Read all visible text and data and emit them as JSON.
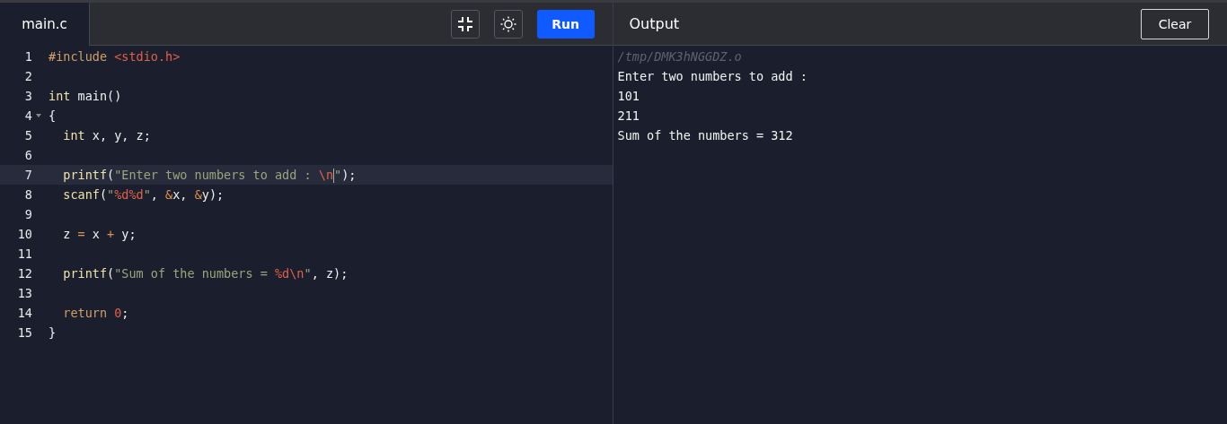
{
  "editor": {
    "tab": {
      "label": "main.c",
      "selected": true
    },
    "buttons": [
      {
        "kind": "collapse"
      },
      {
        "kind": "theme"
      },
      {
        "kind": "run",
        "label": "Run"
      }
    ],
    "lines": [
      {
        "number": "1",
        "active": false,
        "foldable": false,
        "indented": false,
        "tokens": [
          {
            "kind": "directive",
            "text": "#include "
          },
          {
            "kind": "header",
            "text": "<stdio.h>"
          }
        ]
      },
      {
        "number": "2",
        "active": false,
        "foldable": false
      },
      {
        "number": "3",
        "active": false,
        "foldable": false,
        "indented": false,
        "tokens": [
          {
            "kind": "type",
            "text": "int"
          },
          {
            "kind": "plain",
            "text": " main()"
          }
        ]
      },
      {
        "number": "4",
        "active": false,
        "foldable": true,
        "indented": false,
        "tokens": [
          {
            "kind": "plain",
            "text": "{"
          }
        ]
      },
      {
        "number": "5",
        "active": false,
        "foldable": false,
        "indented": true,
        "tokens": [
          {
            "kind": "type",
            "text": "int"
          },
          {
            "kind": "plain",
            "text": " x, y, z;"
          }
        ]
      },
      {
        "number": "6",
        "active": false,
        "foldable": false
      },
      {
        "number": "7",
        "active": true,
        "foldable": false,
        "indented": true,
        "tokens": [
          {
            "kind": "function",
            "text": "printf"
          },
          {
            "kind": "plain",
            "text": "("
          },
          {
            "kind": "string",
            "text": "\"Enter two numbers to add : "
          },
          {
            "kind": "escape",
            "text": "\\n"
          },
          {
            "kind": "string",
            "text": "\""
          },
          {
            "kind": "plain",
            "text": ");"
          }
        ]
      },
      {
        "number": "8",
        "active": false,
        "foldable": false,
        "indented": true,
        "tokens": [
          {
            "kind": "function",
            "text": "scanf"
          },
          {
            "kind": "plain",
            "text": "("
          },
          {
            "kind": "string",
            "text": "\""
          },
          {
            "kind": "escape",
            "text": "%d%d"
          },
          {
            "kind": "string",
            "text": "\""
          },
          {
            "kind": "plain",
            "text": ", "
          },
          {
            "kind": "operator",
            "text": "&"
          },
          {
            "kind": "plain",
            "text": "x, "
          },
          {
            "kind": "operator",
            "text": "&"
          },
          {
            "kind": "plain",
            "text": "y);"
          }
        ]
      },
      {
        "number": "9",
        "active": false,
        "foldable": false
      },
      {
        "number": "10",
        "active": false,
        "foldable": false,
        "indented": true,
        "tokens": [
          {
            "kind": "plain",
            "text": "z "
          },
          {
            "kind": "operator",
            "text": "="
          },
          {
            "kind": "plain",
            "text": " x "
          },
          {
            "kind": "operator",
            "text": "+"
          },
          {
            "kind": "plain",
            "text": " y;"
          }
        ]
      },
      {
        "number": "11",
        "active": false,
        "foldable": false
      },
      {
        "number": "12",
        "active": false,
        "foldable": false,
        "indented": true,
        "tokens": [
          {
            "kind": "function",
            "text": "printf"
          },
          {
            "kind": "plain",
            "text": "("
          },
          {
            "kind": "string",
            "text": "\"Sum of the numbers = "
          },
          {
            "kind": "escape",
            "text": "%d\\n"
          },
          {
            "kind": "string",
            "text": "\""
          },
          {
            "kind": "plain",
            "text": ", z);"
          }
        ]
      },
      {
        "number": "13",
        "active": false,
        "foldable": false
      },
      {
        "number": "14",
        "active": false,
        "foldable": false,
        "indented": true,
        "tokens": [
          {
            "kind": "keyword",
            "text": "return "
          },
          {
            "kind": "number",
            "text": "0"
          },
          {
            "kind": "plain",
            "text": ";"
          }
        ]
      },
      {
        "number": "15",
        "active": false,
        "foldable": false,
        "indented": false,
        "tokens": [
          {
            "kind": "plain",
            "text": "}"
          }
        ]
      }
    ]
  },
  "output": {
    "title": "Output",
    "clear_button": "Clear",
    "lines": [
      {
        "kind": "path",
        "text": "/tmp/DMK3hNGGDZ.o"
      },
      {
        "kind": "stdout",
        "text": "Enter two numbers to add :"
      },
      {
        "kind": "stdout",
        "text": "101"
      },
      {
        "kind": "stdout",
        "text": "211"
      },
      {
        "kind": "stdout",
        "text": "Sum of the numbers = 312"
      }
    ]
  }
}
